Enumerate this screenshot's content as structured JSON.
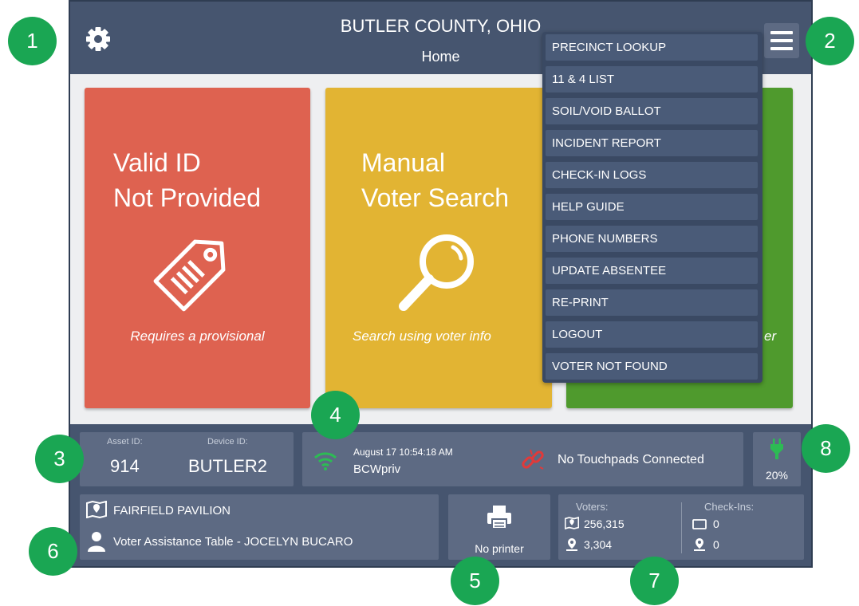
{
  "header": {
    "title": "BUTLER COUNTY, OHIO",
    "subtitle": "Home"
  },
  "tiles": [
    {
      "title_line1": "Valid ID",
      "title_line2": "Not Provided",
      "subtitle": "Requires a provisional",
      "icon": "tag-icon",
      "color": "#de6250"
    },
    {
      "title_line1": "Manual",
      "title_line2": "Voter Search",
      "subtitle": "Search using voter info",
      "icon": "magnifier-icon",
      "color": "#e2b433"
    },
    {
      "subtitle_fragment": "er",
      "color": "#4f9a2d"
    }
  ],
  "menu": {
    "items": [
      "PRECINCT LOOKUP",
      "11 & 4 LIST",
      "SOIL/VOID BALLOT",
      "INCIDENT REPORT",
      "CHECK-IN LOGS",
      "HELP GUIDE",
      "PHONE NUMBERS",
      "UPDATE ABSENTEE",
      "RE-PRINT",
      "LOGOUT",
      "VOTER NOT FOUND"
    ]
  },
  "device": {
    "asset_label": "Asset ID:",
    "asset_id": "914",
    "device_label": "Device ID:",
    "device_id": "BUTLER2"
  },
  "network": {
    "datetime": "August 17  10:54:18 AM",
    "ssid": "BCWpriv",
    "touchpads": "No Touchpads Connected"
  },
  "battery": {
    "percent": "20%"
  },
  "location": {
    "site": "FAIRFIELD PAVILION",
    "table": "Voter Assistance Table - JOCELYN BUCARO"
  },
  "printer": {
    "status": "No printer"
  },
  "stats": {
    "voters_label": "Voters:",
    "voters_total": "256,315",
    "voters_precinct": "3,304",
    "checkins_label": "Check-Ins:",
    "checkins_total": "0",
    "checkins_precinct": "0"
  },
  "callouts": [
    "1",
    "2",
    "3",
    "4",
    "5",
    "6",
    "7",
    "8"
  ],
  "colors": {
    "header": "#46556f",
    "callout": "#1aa653",
    "accent_red": "#e03a3a"
  }
}
